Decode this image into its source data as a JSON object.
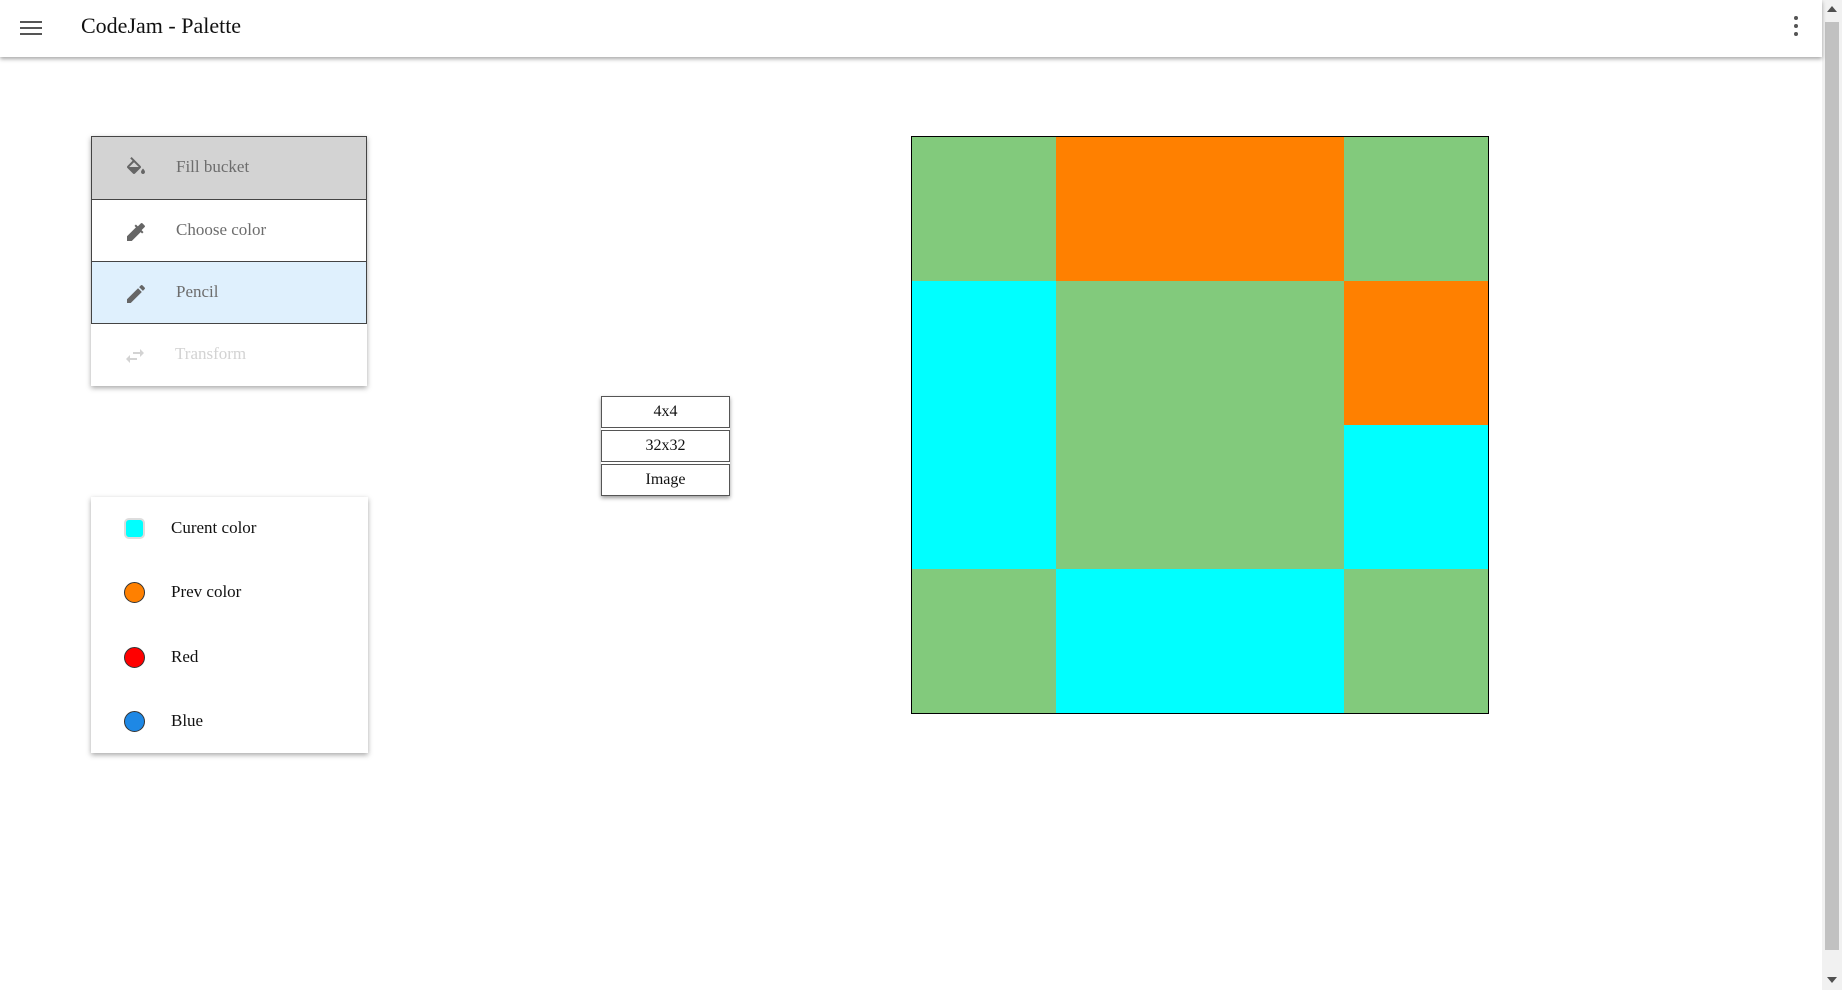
{
  "header": {
    "title": "CodeJam - Palette"
  },
  "tools": [
    {
      "label": "Fill bucket",
      "icon": "fill-bucket-icon",
      "state": "hover"
    },
    {
      "label": "Choose color",
      "icon": "eyedropper-icon",
      "state": "normal"
    },
    {
      "label": "Pencil",
      "icon": "pencil-icon",
      "state": "active"
    },
    {
      "label": "Transform",
      "icon": "swap-arrows-icon",
      "state": "disabled"
    }
  ],
  "colors": [
    {
      "label": "Curent color",
      "color": "#00ffff"
    },
    {
      "label": "Prev color",
      "color": "#ff8000"
    },
    {
      "label": "Red",
      "color": "#ff0000"
    },
    {
      "label": "Blue",
      "color": "#1e88e5"
    }
  ],
  "canvas_sizes": [
    "4x4",
    "32x32",
    "Image"
  ],
  "canvas": {
    "size": "4x4",
    "palette": {
      "green": "#82ca7c",
      "orange": "#ff8000",
      "cyan": "#00ffff"
    },
    "rows": [
      [
        "green",
        "orange",
        "orange",
        "green"
      ],
      [
        "cyan",
        "green",
        "green",
        "orange"
      ],
      [
        "cyan",
        "green",
        "green",
        "cyan"
      ],
      [
        "green",
        "cyan",
        "cyan",
        "green"
      ]
    ]
  }
}
